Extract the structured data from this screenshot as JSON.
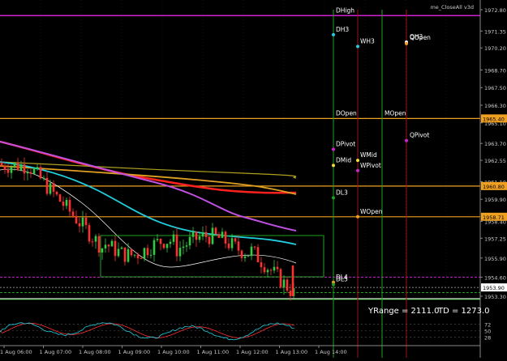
{
  "window": {
    "indicator_label": "me_CloseAll v3d",
    "yrange_text": "YRange = 2111.0",
    "td_text": "TD = 1273.0"
  },
  "colors": {
    "background": "#000000",
    "bull": "#2ecc40",
    "bear": "#ff3030",
    "magenta": "#d020d0",
    "orange": "#f0a020",
    "green_line": "#1fa01f",
    "darkred_line": "#a01010",
    "cyan": "#20d0e0",
    "grid": "#2a2a2a",
    "axis_text": "#c8c8c8"
  },
  "price_axis": {
    "ticks": [
      "1972.80",
      "1971.35",
      "1970.20",
      "1968.70",
      "1967.50",
      "1966.30",
      "1965.10",
      "1963.70",
      "1962.55",
      "1961.10",
      "1959.90",
      "1958.40",
      "1957.25",
      "1955.90",
      "1954.60",
      "1953.30"
    ],
    "tags": [
      {
        "text": "1965.40",
        "price": 1965.4,
        "color": "#f0a020"
      },
      {
        "text": "1960.80",
        "price": 1960.8,
        "color": "#f0a020"
      },
      {
        "text": "1958.71",
        "price": 1958.71,
        "color": "#f0a020"
      },
      {
        "text": "1953.90",
        "price": 1953.9,
        "color": "#ffffff"
      }
    ]
  },
  "time_axis": {
    "labels": [
      "1 Aug 06:00",
      "1 Aug 07:00",
      "1 Aug 08:00",
      "1 Aug 09:00",
      "1 Aug 10:00",
      "1 Aug 11:00",
      "1 Aug 12:00",
      "1 Aug 13:00",
      "1 Aug 14:00"
    ]
  },
  "levels": [
    {
      "name": "DHigh",
      "price": 1972.4,
      "color": "#d020d0",
      "label_color": "#ffffff"
    },
    {
      "name": "DOpen",
      "price": 1965.4,
      "color": "#f0a020",
      "label_color": "#ffffff"
    },
    {
      "name": "MOpen",
      "price": 1965.4,
      "color": "#f0a020",
      "label_color": "#ffffff"
    },
    {
      "name": "DL3",
      "price": 1960.8,
      "color": "#f0a020",
      "label_color": "#ffffff"
    },
    {
      "name": "WOpen",
      "price": 1958.71,
      "color": "#f0a020",
      "label_color": "#ffffff"
    }
  ],
  "pivot_points": [
    {
      "name": "DH3",
      "price": 1971.1,
      "col": "D",
      "color": "#20d0e0"
    },
    {
      "name": "WH3",
      "price": 1970.3,
      "col": "W",
      "color": "#20d0e0"
    },
    {
      "name": "QH3",
      "price": 1970.6,
      "col": "Q",
      "color": "#ffffff"
    },
    {
      "name": "QOpen",
      "price": 1970.55,
      "col": "Q",
      "color": "#f0a020"
    },
    {
      "name": "QPivot",
      "price": 1963.9,
      "col": "Q",
      "color": "#d020d0"
    },
    {
      "name": "DPivot",
      "price": 1963.3,
      "col": "D",
      "color": "#d020d0"
    },
    {
      "name": "WMid",
      "price": 1962.55,
      "col": "W",
      "color": "#f0e030"
    },
    {
      "name": "DMid",
      "price": 1962.2,
      "col": "D",
      "color": "#f0e030"
    },
    {
      "name": "WPivot",
      "price": 1961.85,
      "col": "W",
      "color": "#d020d0"
    },
    {
      "name": "DL3",
      "price": 1960.0,
      "col": "D",
      "color": "#1fa01f"
    },
    {
      "name": "WOpen",
      "price": 1958.71,
      "col": "W",
      "color": "#f0a020"
    },
    {
      "name": "DL4",
      "price": 1954.25,
      "col": "D",
      "color": "#f0a020"
    },
    {
      "name": "DL5",
      "price": 1954.1,
      "col": "D",
      "color": "#1fa01f"
    }
  ],
  "oscillator": {
    "ticks": [
      "72",
      "50",
      "28"
    ]
  }
}
